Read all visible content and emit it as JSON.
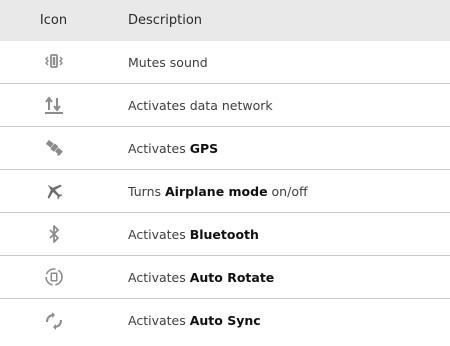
{
  "table": {
    "header": {
      "icon": "Icon",
      "description": "Description"
    },
    "rows": [
      {
        "icon": "vibrate-icon",
        "prefix": "Mutes sound",
        "strong": "",
        "suffix": ""
      },
      {
        "icon": "data-network-icon",
        "prefix": "Activates data network",
        "strong": "",
        "suffix": ""
      },
      {
        "icon": "satellite-gps-icon",
        "prefix": "Activates ",
        "strong": "GPS",
        "suffix": ""
      },
      {
        "icon": "airplane-icon",
        "prefix": "Turns ",
        "strong": "Airplane mode",
        "suffix": " on/off"
      },
      {
        "icon": "bluetooth-icon",
        "prefix": "Activates ",
        "strong": "Bluetooth",
        "suffix": ""
      },
      {
        "icon": "auto-rotate-icon",
        "prefix": "Activates ",
        "strong": "Auto Rotate",
        "suffix": ""
      },
      {
        "icon": "auto-sync-icon",
        "prefix": "Activates ",
        "strong": "Auto Sync",
        "suffix": ""
      }
    ]
  },
  "colors": {
    "header_bg": "#e9e9e9",
    "icon_gray": "#8c8c8c",
    "divider": "#c9c9c9"
  }
}
